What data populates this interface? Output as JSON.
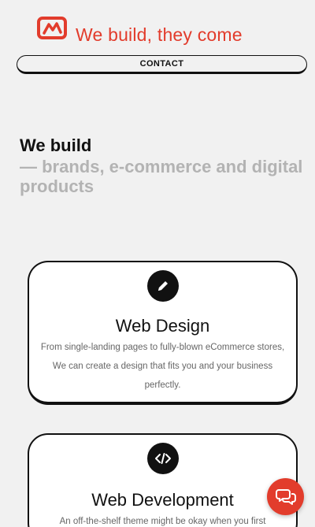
{
  "header": {
    "tagline": "We build, they come",
    "logo_icon": "chart-logo-icon",
    "contact_label": "CONTACT"
  },
  "hero": {
    "title": "We build",
    "subtitle": "— brands, e-commerce and digital products"
  },
  "services": [
    {
      "icon": "pencil-icon",
      "title": "Web Design",
      "description": "From single-landing pages to fully-blown eCommerce stores, We can create a design that fits you and your business perfectly."
    },
    {
      "icon": "code-icon",
      "title": "Web Development",
      "description": "An off-the-shelf theme might be okay when you first"
    }
  ],
  "chat": {
    "icon": "chat-bubbles-icon"
  },
  "colors": {
    "accent": "#e23c2c",
    "background": "#f1f1f1",
    "text": "#111111",
    "muted": "#b3b3b3",
    "card_bg": "#ffffff"
  }
}
